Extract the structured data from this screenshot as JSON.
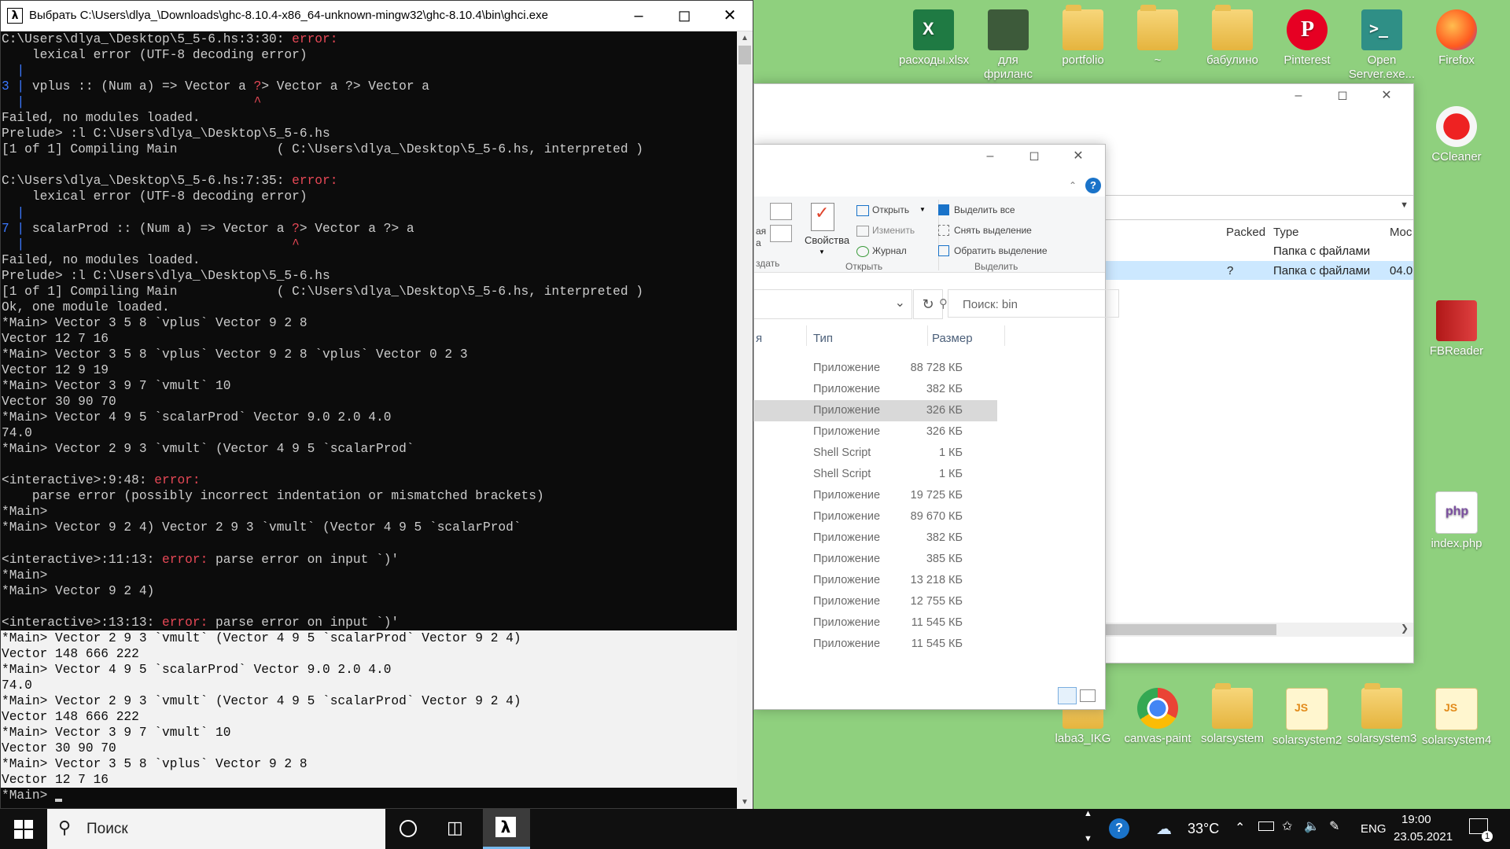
{
  "terminal": {
    "title": "Выбрать C:\\Users\\dlya_\\Downloads\\ghc-8.10.4-x86_64-unknown-mingw32\\ghc-8.10.4\\bin\\ghci.exe",
    "lines": [
      {
        "pre": "C:\\Users\\dlya_\\Desktop\\5_5-6.hs:3:30: ",
        "err": "error:",
        "post": ""
      },
      {
        "pre": "    lexical error (UTF-8 decoding error)",
        "err": "",
        "post": ""
      },
      {
        "pre": "  ",
        "blue": "|",
        "post": ""
      },
      {
        "pre": "",
        "blue": "3 |",
        "post": " vplus :: (Num a) => Vector a ",
        "err": "?",
        "post2": "> Vector a ?> Vector a"
      },
      {
        "pre": "  ",
        "blue": "|",
        "post": "                              ",
        "err": "^",
        "post2": ""
      },
      {
        "pre": "Failed, no modules loaded.",
        "err": "",
        "post": ""
      },
      {
        "pre": "Prelude> :l C:\\Users\\dlya_\\Desktop\\5_5-6.hs",
        "err": "",
        "post": ""
      },
      {
        "pre": "[1 of 1] Compiling Main             ( C:\\Users\\dlya_\\Desktop\\5_5-6.hs, interpreted )",
        "err": "",
        "post": ""
      },
      {
        "pre": "",
        "err": "",
        "post": ""
      },
      {
        "pre": "C:\\Users\\dlya_\\Desktop\\5_5-6.hs:7:35: ",
        "err": "error:",
        "post": ""
      },
      {
        "pre": "    lexical error (UTF-8 decoding error)",
        "err": "",
        "post": ""
      },
      {
        "pre": "  ",
        "blue": "|",
        "post": ""
      },
      {
        "pre": "",
        "blue": "7 |",
        "post": " scalarProd :: (Num a) => Vector a ",
        "err": "?",
        "post2": "> Vector a ?> a"
      },
      {
        "pre": "  ",
        "blue": "|",
        "post": "                                   ",
        "err": "^",
        "post2": ""
      },
      {
        "pre": "Failed, no modules loaded.",
        "err": "",
        "post": ""
      },
      {
        "pre": "Prelude> :l C:\\Users\\dlya_\\Desktop\\5_5-6.hs",
        "err": "",
        "post": ""
      },
      {
        "pre": "[1 of 1] Compiling Main             ( C:\\Users\\dlya_\\Desktop\\5_5-6.hs, interpreted )",
        "err": "",
        "post": ""
      },
      {
        "pre": "Ok, one module loaded.",
        "err": "",
        "post": ""
      },
      {
        "pre": "*Main> Vector 3 5 8 `vplus` Vector 9 2 8",
        "err": "",
        "post": ""
      },
      {
        "pre": "Vector 12 7 16",
        "err": "",
        "post": ""
      },
      {
        "pre": "*Main> Vector 3 5 8 `vplus` Vector 9 2 8 `vplus` Vector 0 2 3",
        "err": "",
        "post": ""
      },
      {
        "pre": "Vector 12 9 19",
        "err": "",
        "post": ""
      },
      {
        "pre": "*Main> Vector 3 9 7 `vmult` 10",
        "err": "",
        "post": ""
      },
      {
        "pre": "Vector 30 90 70",
        "err": "",
        "post": ""
      },
      {
        "pre": "*Main> Vector 4 9 5 `scalarProd` Vector 9.0 2.0 4.0",
        "err": "",
        "post": ""
      },
      {
        "pre": "74.0",
        "err": "",
        "post": ""
      },
      {
        "pre": "*Main> Vector 2 9 3 `vmult` (Vector 4 9 5 `scalarProd`",
        "err": "",
        "post": ""
      },
      {
        "pre": "",
        "err": "",
        "post": ""
      },
      {
        "pre": "<interactive>:9:48: ",
        "err": "error:",
        "post": ""
      },
      {
        "pre": "    parse error (possibly incorrect indentation or mismatched brackets)",
        "err": "",
        "post": ""
      },
      {
        "pre": "*Main>",
        "err": "",
        "post": ""
      },
      {
        "pre": "*Main> Vector 9 2 4) Vector 2 9 3 `vmult` (Vector 4 9 5 `scalarProd`",
        "err": "",
        "post": ""
      },
      {
        "pre": "",
        "err": "",
        "post": ""
      },
      {
        "pre": "<interactive>:11:13: ",
        "err": "error:",
        "post": " parse error on input `)'"
      },
      {
        "pre": "*Main>",
        "err": "",
        "post": ""
      },
      {
        "pre": "*Main> Vector 9 2 4)",
        "err": "",
        "post": ""
      },
      {
        "pre": "",
        "err": "",
        "post": ""
      },
      {
        "pre": "<interactive>:13:13: ",
        "err": "error:",
        "post": " parse error on input `)'"
      }
    ],
    "selected_lines": [
      "*Main> Vector 2 9 3 `vmult` (Vector 4 9 5 `scalarProd` Vector 9 2 4)",
      "Vector 148 666 222",
      "*Main> Vector 4 9 5 `scalarProd` Vector 9.0 2.0 4.0",
      "74.0",
      "*Main> Vector 2 9 3 `vmult` (Vector 4 9 5 `scalarProd` Vector 9 2 4)",
      "Vector 148 666 222",
      "*Main> Vector 3 9 7 `vmult` 10",
      "Vector 30 90 70",
      "*Main> Vector 3 5 8 `vplus` Vector 9 2 8",
      "Vector 12 7 16"
    ],
    "prompt": "*Main> "
  },
  "explorer_back": {
    "col_packed": "Packed",
    "col_type": "Type",
    "col_mod": "Moc",
    "rows": [
      {
        "q": "",
        "type": "Папка с файлами",
        "mod": ""
      },
      {
        "q": "?",
        "type": "Папка с файлами",
        "mod": "04.0"
      }
    ]
  },
  "explorer_front": {
    "ribbon": {
      "properties": "Свойства",
      "open": "Открыть",
      "edit": "Изменить",
      "history": "Журнал",
      "select_all": "Выделить все",
      "deselect": "Снять выделение",
      "invert": "Обратить выделение",
      "group_open": "Открыть",
      "group_select": "Выделить",
      "group_create": "здать",
      "frag1": "ая",
      "frag2": "а"
    },
    "search_placeholder": "Поиск: bin",
    "col_name": "я",
    "col_type": "Тип",
    "col_size": "Размер",
    "files": [
      {
        "type": "Приложение",
        "size": "88 728 КБ"
      },
      {
        "type": "Приложение",
        "size": "382 КБ"
      },
      {
        "type": "Приложение",
        "size": "326 КБ"
      },
      {
        "type": "Приложение",
        "size": "326 КБ"
      },
      {
        "type": "Shell Script",
        "size": "1 КБ"
      },
      {
        "type": "Shell Script",
        "size": "1 КБ"
      },
      {
        "type": "Приложение",
        "size": "19 725 КБ"
      },
      {
        "type": "Приложение",
        "size": "89 670 КБ"
      },
      {
        "type": "Приложение",
        "size": "382 КБ"
      },
      {
        "type": "Приложение",
        "size": "385 КБ"
      },
      {
        "type": "Приложение",
        "size": "13 218 КБ"
      },
      {
        "type": "Приложение",
        "size": "12 755 КБ"
      },
      {
        "type": "Приложение",
        "size": "11 545 КБ"
      },
      {
        "type": "Приложение",
        "size": "11 545 КБ"
      }
    ]
  },
  "desktop_icons": {
    "top": [
      "расходы.xlsx",
      "для фриланс биржи",
      "portfolio",
      "~",
      "бабулино",
      "Pinterest",
      "Open Server.exe...",
      "Firefox"
    ],
    "right": [
      "CCleaner",
      "FBReader",
      "index.php"
    ],
    "bottom": [
      "laba3_IKG",
      "canvas-paint",
      "solarsystem",
      "solarsystem2",
      "solarsystem3",
      "solarsystem4"
    ]
  },
  "taskbar": {
    "search_label": "Поиск",
    "temperature": "33°C",
    "lang": "ENG",
    "time": "19:00",
    "date": "23.05.2021",
    "notification_count": "1"
  },
  "colors": {
    "error": "#e74856",
    "gutter": "#3b78ff",
    "desktop": "#8fd07e"
  }
}
